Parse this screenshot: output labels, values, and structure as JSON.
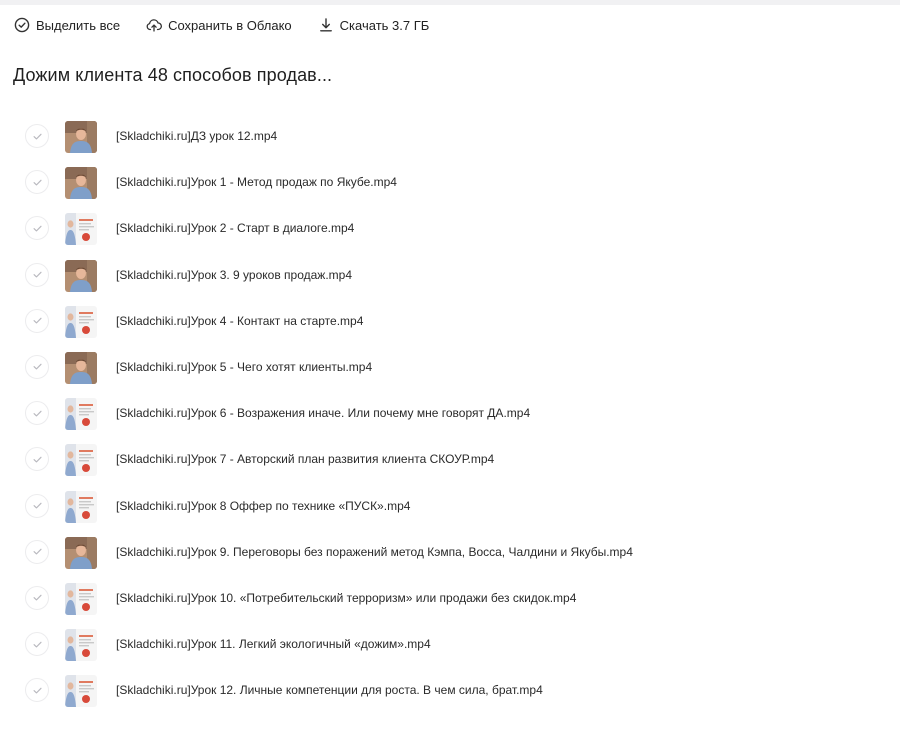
{
  "toolbar": {
    "select_all": "Выделить все",
    "save_to_cloud": "Сохранить в Облако",
    "download": "Скачать 3.7 ГБ"
  },
  "folder": {
    "title": "Дожим клиента 48 способов продав..."
  },
  "files": [
    {
      "name": "[Skladchiki.ru]ДЗ урок 12.mp4",
      "thumb": "person"
    },
    {
      "name": "[Skladchiki.ru]Урок 1 - Метод продаж по Якубе.mp4",
      "thumb": "person"
    },
    {
      "name": "[Skladchiki.ru]Урок 2 - Старт в диалоге.mp4",
      "thumb": "slide"
    },
    {
      "name": "[Skladchiki.ru]Урок 3. 9 уроков продаж.mp4",
      "thumb": "person"
    },
    {
      "name": "[Skladchiki.ru]Урок 4 - Контакт на старте.mp4",
      "thumb": "slide"
    },
    {
      "name": "[Skladchiki.ru]Урок 5 - Чего хотят клиенты.mp4",
      "thumb": "person"
    },
    {
      "name": "[Skladchiki.ru]Урок 6 - Возражения иначе. Или почему мне говорят ДА.mp4",
      "thumb": "slide"
    },
    {
      "name": "[Skladchiki.ru]Урок 7 - Авторский план развития клиента СКОУР.mp4",
      "thumb": "slide"
    },
    {
      "name": "[Skladchiki.ru]Урок 8 Оффер по технике «ПУСК».mp4",
      "thumb": "slide"
    },
    {
      "name": "[Skladchiki.ru]Урок 9. Переговоры без поражений метод Кэмпа, Восса, Чалдини и Якубы.mp4",
      "thumb": "person"
    },
    {
      "name": "[Skladchiki.ru]Урок 10. «Потребительский терроризм» или продажи без скидок.mp4",
      "thumb": "slide"
    },
    {
      "name": "[Skladchiki.ru]Урок 11. Легкий экологичный «дожим».mp4",
      "thumb": "slide"
    },
    {
      "name": "[Skladchiki.ru]Урок 12. Личные компетенции для роста. В чем сила, брат.mp4",
      "thumb": "slide"
    }
  ],
  "icons": {
    "select_all": "check-circle-icon",
    "save_to_cloud": "cloud-upload-icon",
    "download": "download-icon",
    "row_check": "check-icon"
  }
}
